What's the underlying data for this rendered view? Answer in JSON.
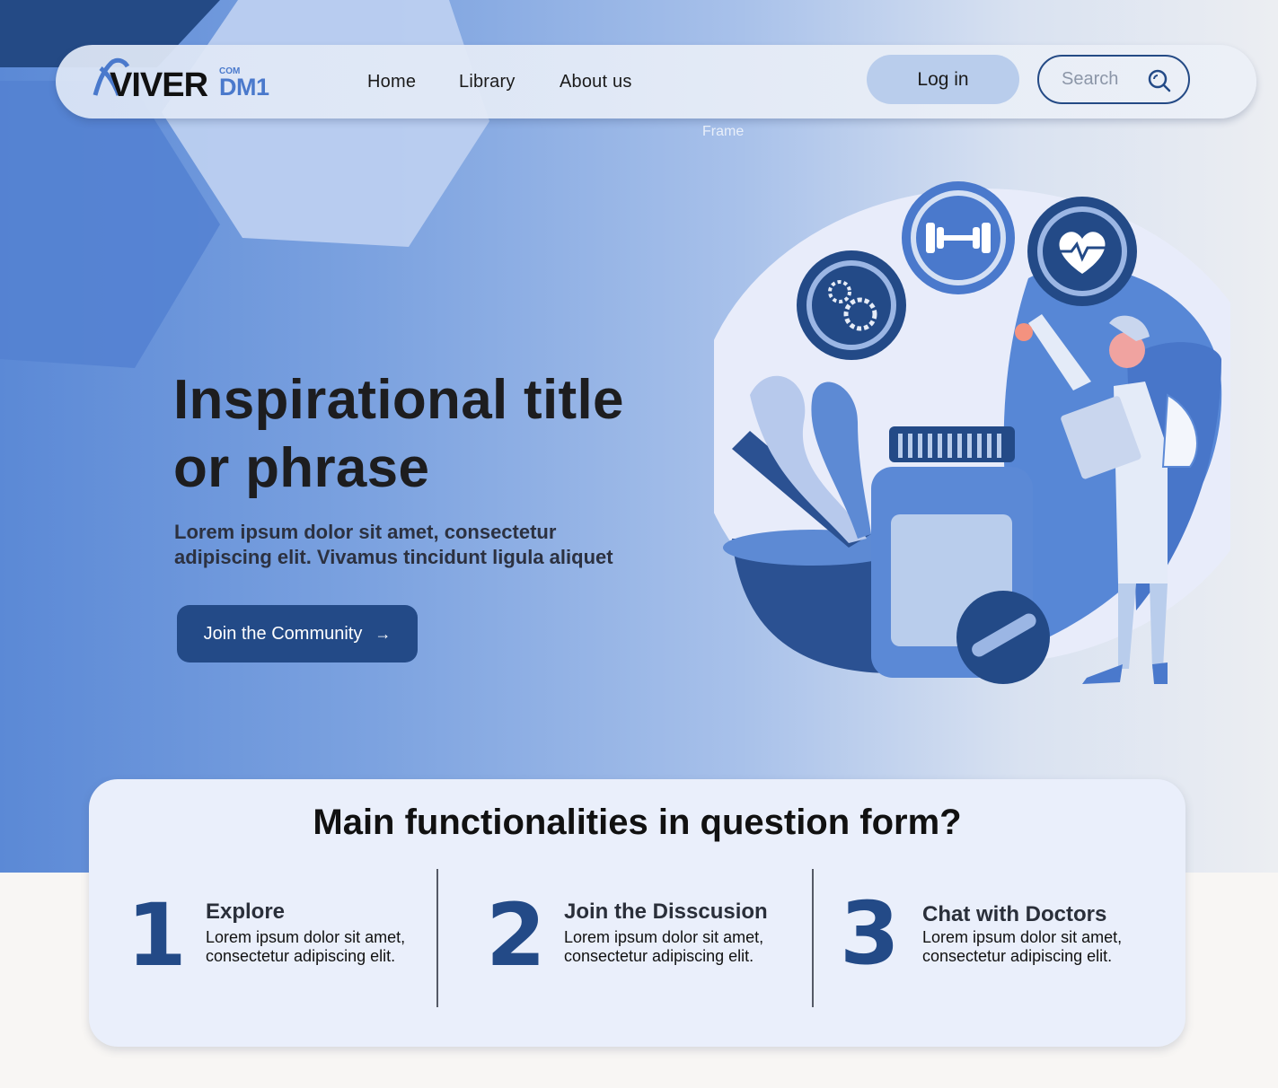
{
  "brand": {
    "name": "VIVER",
    "suffix": "DM1",
    "tld": "COM"
  },
  "nav": {
    "links": [
      {
        "label": "Home"
      },
      {
        "label": "Library"
      },
      {
        "label": "About us"
      }
    ],
    "login_label": "Log in",
    "search_placeholder": "Search",
    "search_icon": "search-icon"
  },
  "frame_label": "Frame",
  "hero": {
    "title": "Inspirational title or phrase",
    "subtitle": "Lorem ipsum dolor sit amet, consectetur adipiscing elit. Vivamus tincidunt ligula aliquet",
    "cta_label": "Join the Community",
    "cta_arrow": "→",
    "illustration_icons": [
      "gears-icon",
      "dumbbell-icon",
      "heart-pulse-icon",
      "pill-bottle-icon",
      "doctor-figure"
    ]
  },
  "features": {
    "title": "Main functionalities in question form?",
    "items": [
      {
        "number": "1",
        "title": "Explore",
        "description": "Lorem ipsum dolor sit amet, consectetur adipiscing elit."
      },
      {
        "number": "2",
        "title": "Join the Disscusion",
        "description": "Lorem ipsum dolor sit amet, consectetur adipiscing elit."
      },
      {
        "number": "3",
        "title": "Chat with Doctors",
        "description": "Lorem ipsum dolor sit amet, consectetur adipiscing elit."
      }
    ]
  },
  "colors": {
    "primary": "#234a87",
    "accent_light": "#b9cdec",
    "card_bg": "#eaeffb",
    "hero_blue": "#5b89d6"
  }
}
